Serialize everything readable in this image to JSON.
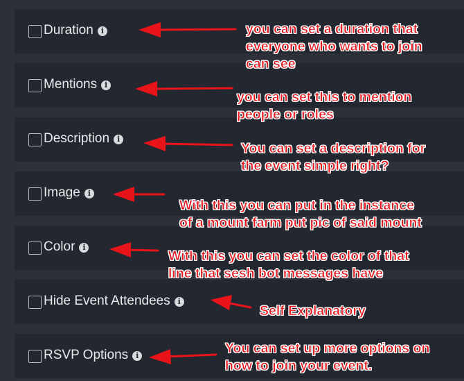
{
  "options": [
    {
      "label": "Duration",
      "checked": false
    },
    {
      "label": "Mentions",
      "checked": false
    },
    {
      "label": "Description",
      "checked": false
    },
    {
      "label": "Image",
      "checked": false
    },
    {
      "label": "Color",
      "checked": false
    },
    {
      "label": "Hide Event Attendees",
      "checked": false
    },
    {
      "label": "RSVP Options",
      "checked": false
    }
  ],
  "info_icon_glyph": "i",
  "annotations": {
    "color": "#e8141a",
    "notes": [
      [
        "you can set a duration that",
        "everyone who wants to join",
        "can see"
      ],
      [
        "you can set this to mention",
        "people or roles"
      ],
      [
        "You can set a description for",
        "the event simple right?"
      ],
      [
        "With this you can put in the instance",
        "of a mount farm put pic of said mount"
      ],
      [
        "With this you can set the color of that",
        "line that sesh bot messages have"
      ],
      [
        "Self Explanatory"
      ],
      [
        "You can set up more options on",
        "how to join your event."
      ]
    ]
  }
}
